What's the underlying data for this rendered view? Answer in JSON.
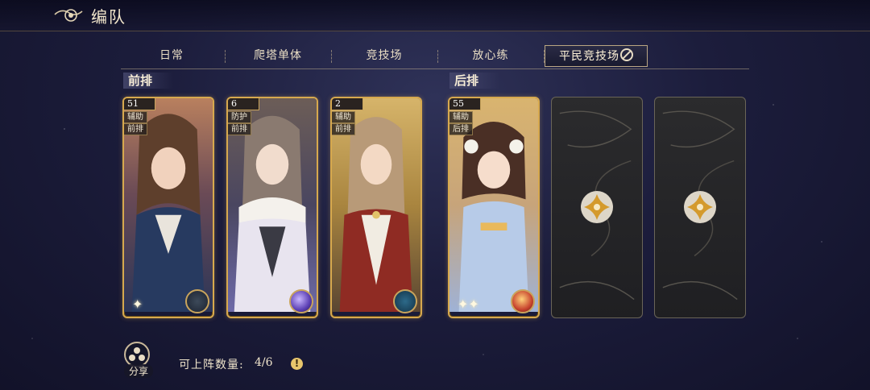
{
  "header": {
    "title": "编队",
    "emblem_icon": "swirl-emblem-icon"
  },
  "tabs": [
    {
      "label": "日常",
      "active": false
    },
    {
      "label": "爬塔单体",
      "active": false
    },
    {
      "label": "竞技场",
      "active": false
    },
    {
      "label": "放心练",
      "active": false
    },
    {
      "label": "平民竞技场",
      "active": true,
      "suffix_icon": "ban-icon"
    }
  ],
  "front_row": {
    "label": "前排",
    "cards": [
      {
        "level": "51",
        "role": "辅助",
        "position": "前排",
        "element_icon": "compass-element-icon"
      },
      {
        "level": "6",
        "role": "防护",
        "position": "前排",
        "element_icon": "purple-orb-element-icon"
      },
      {
        "level": "2",
        "role": "辅助",
        "position": "前排",
        "element_icon": "compass-element-icon"
      }
    ]
  },
  "back_row": {
    "label": "后排",
    "cards": [
      {
        "level": "55",
        "role": "辅助",
        "position": "后排",
        "element_icon": "red-orb-element-icon"
      }
    ],
    "empty_slots": 2
  },
  "footer": {
    "share_label": "分享",
    "deploy_label": "可上阵数量:",
    "deploy_count": "4/6",
    "info_glyph": "!"
  },
  "colors": {
    "gold_border": "#d7a94e",
    "background": "#1c1d3c",
    "accent_text": "#f0e6cf"
  }
}
